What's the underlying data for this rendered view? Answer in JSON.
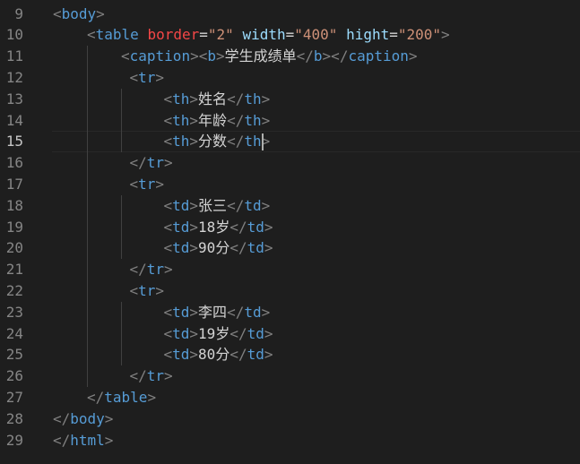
{
  "editor": {
    "lines": [
      {
        "n": "9",
        "indent": 0,
        "tokens": [
          [
            "brk",
            "<"
          ],
          [
            "tag",
            "body"
          ],
          [
            "brk",
            ">"
          ]
        ]
      },
      {
        "n": "10",
        "indent": 1,
        "tokens": [
          [
            "brk",
            "<"
          ],
          [
            "tag",
            "table"
          ],
          [
            "txt",
            " "
          ],
          [
            "attr-hl",
            "border"
          ],
          [
            "eq",
            "="
          ],
          [
            "str",
            "\"2\""
          ],
          [
            "txt",
            " "
          ],
          [
            "attr",
            "width"
          ],
          [
            "eq",
            "="
          ],
          [
            "str",
            "\"400\""
          ],
          [
            "txt",
            " "
          ],
          [
            "attr",
            "hight"
          ],
          [
            "eq",
            "="
          ],
          [
            "str",
            "\"200\""
          ],
          [
            "brk",
            ">"
          ]
        ]
      },
      {
        "n": "11",
        "indent": 2,
        "tokens": [
          [
            "brk",
            "<"
          ],
          [
            "tag",
            "caption"
          ],
          [
            "brk",
            "><"
          ],
          [
            "tag",
            "b"
          ],
          [
            "brk",
            ">"
          ],
          [
            "txt",
            "学生成绩单"
          ],
          [
            "brk",
            "</"
          ],
          [
            "tag",
            "b"
          ],
          [
            "brk",
            "></"
          ],
          [
            "tag",
            "caption"
          ],
          [
            "brk",
            ">"
          ]
        ]
      },
      {
        "n": "12",
        "indent": 2.25,
        "tokens": [
          [
            "brk",
            "<"
          ],
          [
            "tag",
            "tr"
          ],
          [
            "brk",
            ">"
          ]
        ]
      },
      {
        "n": "13",
        "indent": 3.25,
        "tokens": [
          [
            "brk",
            "<"
          ],
          [
            "tag",
            "th"
          ],
          [
            "brk",
            ">"
          ],
          [
            "txt",
            "姓名"
          ],
          [
            "brk",
            "</"
          ],
          [
            "tag",
            "th"
          ],
          [
            "brk",
            ">"
          ]
        ]
      },
      {
        "n": "14",
        "indent": 3.25,
        "tokens": [
          [
            "brk",
            "<"
          ],
          [
            "tag",
            "th"
          ],
          [
            "brk",
            ">"
          ],
          [
            "txt",
            "年龄"
          ],
          [
            "brk",
            "</"
          ],
          [
            "tag",
            "th"
          ],
          [
            "brk",
            ">"
          ]
        ]
      },
      {
        "n": "15",
        "indent": 3.25,
        "current": true,
        "tokens": [
          [
            "brk",
            "<"
          ],
          [
            "tag",
            "th"
          ],
          [
            "brk",
            ">"
          ],
          [
            "txt",
            "分数"
          ],
          [
            "brk",
            "</"
          ],
          [
            "tag",
            "th"
          ],
          [
            "brk",
            ">"
          ]
        ]
      },
      {
        "n": "16",
        "indent": 2.25,
        "tokens": [
          [
            "brk",
            "</"
          ],
          [
            "tag",
            "tr"
          ],
          [
            "brk",
            ">"
          ]
        ]
      },
      {
        "n": "17",
        "indent": 2.25,
        "tokens": [
          [
            "brk",
            "<"
          ],
          [
            "tag",
            "tr"
          ],
          [
            "brk",
            ">"
          ]
        ]
      },
      {
        "n": "18",
        "indent": 3.25,
        "tokens": [
          [
            "brk",
            "<"
          ],
          [
            "tag",
            "td"
          ],
          [
            "brk",
            ">"
          ],
          [
            "txt",
            "张三"
          ],
          [
            "brk",
            "</"
          ],
          [
            "tag",
            "td"
          ],
          [
            "brk",
            ">"
          ]
        ]
      },
      {
        "n": "19",
        "indent": 3.25,
        "tokens": [
          [
            "brk",
            "<"
          ],
          [
            "tag",
            "td"
          ],
          [
            "brk",
            ">"
          ],
          [
            "txt",
            "18岁"
          ],
          [
            "brk",
            "</"
          ],
          [
            "tag",
            "td"
          ],
          [
            "brk",
            ">"
          ]
        ]
      },
      {
        "n": "20",
        "indent": 3.25,
        "tokens": [
          [
            "brk",
            "<"
          ],
          [
            "tag",
            "td"
          ],
          [
            "brk",
            ">"
          ],
          [
            "txt",
            "90分"
          ],
          [
            "brk",
            "</"
          ],
          [
            "tag",
            "td"
          ],
          [
            "brk",
            ">"
          ]
        ]
      },
      {
        "n": "21",
        "indent": 2.25,
        "tokens": [
          [
            "brk",
            "</"
          ],
          [
            "tag",
            "tr"
          ],
          [
            "brk",
            ">"
          ]
        ]
      },
      {
        "n": "22",
        "indent": 2.25,
        "tokens": [
          [
            "brk",
            "<"
          ],
          [
            "tag",
            "tr"
          ],
          [
            "brk",
            ">"
          ]
        ]
      },
      {
        "n": "23",
        "indent": 3.25,
        "tokens": [
          [
            "brk",
            "<"
          ],
          [
            "tag",
            "td"
          ],
          [
            "brk",
            ">"
          ],
          [
            "txt",
            "李四"
          ],
          [
            "brk",
            "</"
          ],
          [
            "tag",
            "td"
          ],
          [
            "brk",
            ">"
          ]
        ]
      },
      {
        "n": "24",
        "indent": 3.25,
        "tokens": [
          [
            "brk",
            "<"
          ],
          [
            "tag",
            "td"
          ],
          [
            "brk",
            ">"
          ],
          [
            "txt",
            "19岁"
          ],
          [
            "brk",
            "</"
          ],
          [
            "tag",
            "td"
          ],
          [
            "brk",
            ">"
          ]
        ]
      },
      {
        "n": "25",
        "indent": 3.25,
        "tokens": [
          [
            "brk",
            "<"
          ],
          [
            "tag",
            "td"
          ],
          [
            "brk",
            ">"
          ],
          [
            "txt",
            "80分"
          ],
          [
            "brk",
            "</"
          ],
          [
            "tag",
            "td"
          ],
          [
            "brk",
            ">"
          ]
        ]
      },
      {
        "n": "26",
        "indent": 2.25,
        "tokens": [
          [
            "brk",
            "</"
          ],
          [
            "tag",
            "tr"
          ],
          [
            "brk",
            ">"
          ]
        ]
      },
      {
        "n": "27",
        "indent": 1,
        "tokens": [
          [
            "brk",
            "</"
          ],
          [
            "tag",
            "table"
          ],
          [
            "brk",
            ">"
          ]
        ]
      },
      {
        "n": "28",
        "indent": 0,
        "tokens": [
          [
            "brk",
            "</"
          ],
          [
            "tag",
            "body"
          ],
          [
            "brk",
            ">"
          ]
        ]
      },
      {
        "n": "29",
        "indent": 0,
        "tokens": [
          [
            "brk",
            "</"
          ],
          [
            "tag",
            "html"
          ],
          [
            "brk",
            ">"
          ]
        ]
      }
    ],
    "colors": {
      "background": "#1e1e1e",
      "tag": "#569cd6",
      "bracket": "#808080",
      "attribute": "#9cdcfe",
      "string": "#ce9178",
      "text": "#d4d4d4",
      "line_number": "#858585"
    }
  }
}
